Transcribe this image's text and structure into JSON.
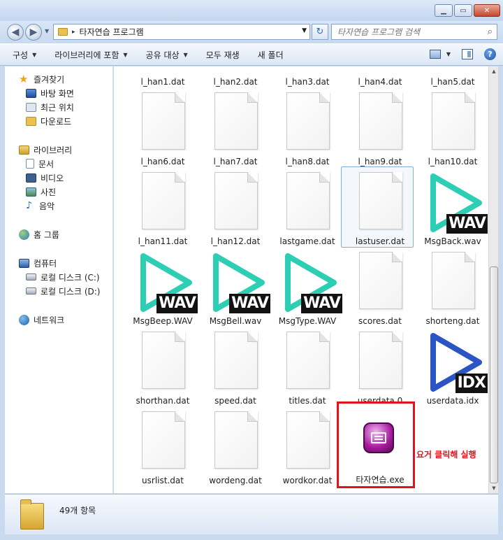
{
  "window": {
    "minimize_glyph": "▁",
    "maximize_glyph": "▭",
    "close_glyph": "✕"
  },
  "address": {
    "path": "타자연습 프로그램",
    "separator": "▸"
  },
  "search": {
    "placeholder": "타자연습 프로그램 검색"
  },
  "toolbar": {
    "organize": "구성",
    "include_library": "라이브러리에 포함",
    "share": "공유 대상",
    "play_all": "모두 재생",
    "new_folder": "새 폴더",
    "help": "?"
  },
  "sidebar": {
    "favorites": {
      "label": "즐겨찾기",
      "items": [
        "바탕 화면",
        "최근 위치",
        "다운로드"
      ]
    },
    "libraries": {
      "label": "라이브러리",
      "items": [
        "문서",
        "비디오",
        "사진",
        "음악"
      ]
    },
    "homegroup": {
      "label": "홈 그룹"
    },
    "computer": {
      "label": "컴퓨터",
      "items": [
        "로컬 디스크 (C:)",
        "로컬 디스크 (D:)"
      ]
    },
    "network": {
      "label": "네트워크"
    }
  },
  "files": [
    {
      "name": "l_han1.dat",
      "type": "doc"
    },
    {
      "name": "l_han2.dat",
      "type": "doc"
    },
    {
      "name": "l_han3.dat",
      "type": "doc"
    },
    {
      "name": "l_han4.dat",
      "type": "doc"
    },
    {
      "name": "l_han5.dat",
      "type": "doc"
    },
    {
      "name": "l_han6.dat",
      "type": "doc"
    },
    {
      "name": "l_han7.dat",
      "type": "doc"
    },
    {
      "name": "l_han8.dat",
      "type": "doc"
    },
    {
      "name": "l_han9.dat",
      "type": "doc"
    },
    {
      "name": "l_han10.dat",
      "type": "doc"
    },
    {
      "name": "l_han11.dat",
      "type": "doc"
    },
    {
      "name": "l_han12.dat",
      "type": "doc"
    },
    {
      "name": "lastgame.dat",
      "type": "doc"
    },
    {
      "name": "lastuser.dat",
      "type": "doc"
    },
    {
      "name": "MsgBack.wav",
      "type": "wav",
      "tag": "WAV"
    },
    {
      "name": "MsgBeep.WAV",
      "type": "wav",
      "tag": "WAV"
    },
    {
      "name": "MsgBell.wav",
      "type": "wav",
      "tag": "WAV"
    },
    {
      "name": "MsgType.WAV",
      "type": "wav",
      "tag": "WAV"
    },
    {
      "name": "scores.dat",
      "type": "doc"
    },
    {
      "name": "shorteng.dat",
      "type": "doc"
    },
    {
      "name": "shorthan.dat",
      "type": "doc"
    },
    {
      "name": "speed.dat",
      "type": "doc"
    },
    {
      "name": "titles.dat",
      "type": "doc"
    },
    {
      "name": "userdata.0",
      "type": "doc"
    },
    {
      "name": "userdata.idx",
      "type": "idx",
      "tag": "IDX"
    },
    {
      "name": "usrlist.dat",
      "type": "doc"
    },
    {
      "name": "wordeng.dat",
      "type": "doc"
    },
    {
      "name": "wordkor.dat",
      "type": "doc"
    },
    {
      "name": "타자연습.exe",
      "type": "exe"
    }
  ],
  "colors": {
    "wav": "#2ccfb3",
    "idx": "#2b55c4",
    "highlight": "#e2141b"
  },
  "annotation": "요거 클릭해 실행",
  "status": {
    "count": "49개 항목"
  }
}
